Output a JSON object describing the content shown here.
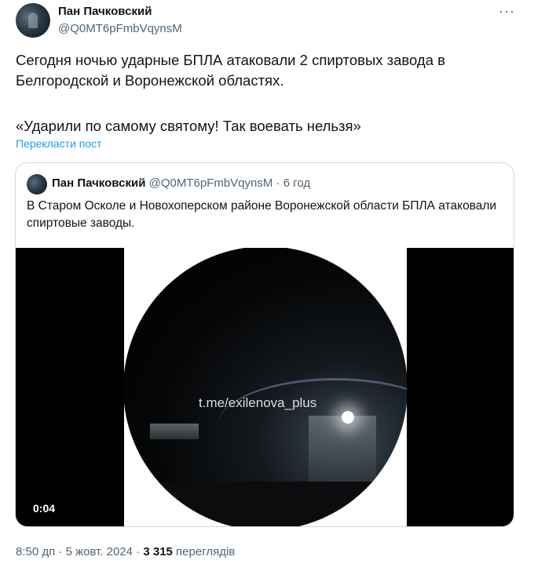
{
  "author": {
    "name": "Пан Пачковский",
    "handle": "@Q0MT6pFmbVqynsM"
  },
  "post": {
    "paragraph1": "Сегодня ночью ударные БПЛА атаковали 2 спиртовых завода в Белгородской и Воронежской областях.",
    "paragraph2": "«Ударили по самому святому! Так воевать нельзя»",
    "translate_label": "Перекласти пост",
    "more_icon": "more-icon"
  },
  "quoted": {
    "name": "Пан Пачковский",
    "handle": "@Q0MT6pFmbVqynsM",
    "separator": " · ",
    "time": "6 год",
    "text": "В Старом Осколе и Новохоперском районе Воронежской области БПЛА атаковали спиртовые заводы.",
    "video": {
      "watermark": "t.me/exilenova_plus",
      "duration": "0:04"
    }
  },
  "footer": {
    "datetime": "8:50 дп · 5 жовт. 2024 · ",
    "views_count": "3 315",
    "views_label": " переглядів"
  }
}
